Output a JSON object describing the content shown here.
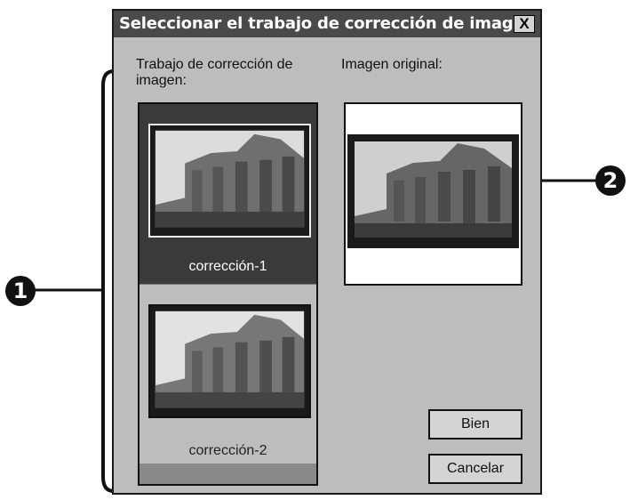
{
  "dialog": {
    "title": "Seleccionar el trabajo de corrección de imagen",
    "close_label": "X"
  },
  "labels": {
    "correction_list": "Trabajo de corrección de\nimagen:",
    "original_image": "Imagen original:"
  },
  "correction_list": {
    "items": [
      {
        "label": "corrección-1",
        "selected": true
      },
      {
        "label": "corrección-2",
        "selected": false
      }
    ]
  },
  "buttons": {
    "ok_label": "Bien",
    "cancel_label": "Cancelar"
  },
  "callouts": {
    "first": "1",
    "second": "2"
  },
  "colors": {
    "titlebar": "#4a4a4a",
    "dialog_bg": "#bdbdbd",
    "selected_item_bg": "#3a3a3a"
  },
  "icons": [
    "close-icon"
  ]
}
